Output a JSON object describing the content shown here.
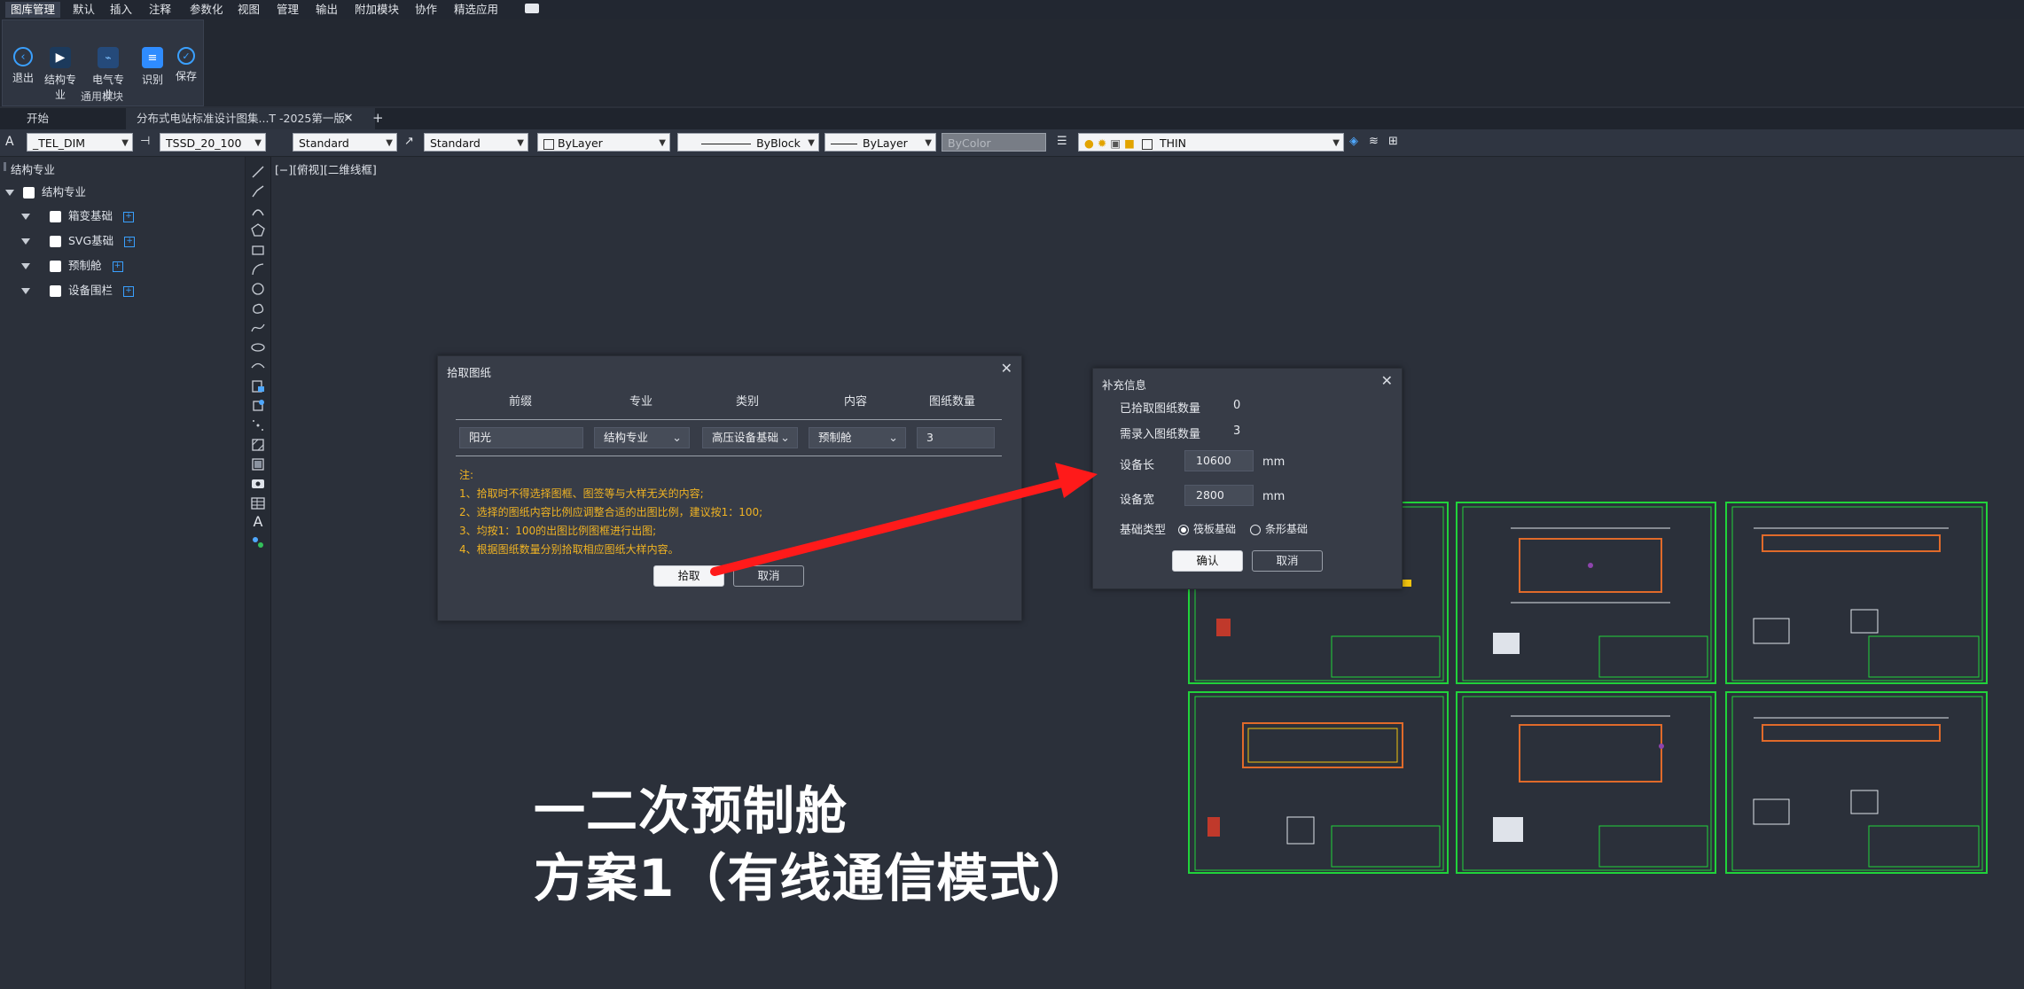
{
  "menu": [
    "图库管理",
    "默认",
    "插入",
    "注释",
    "参数化",
    "视图",
    "管理",
    "输出",
    "附加模块",
    "协作",
    "精选应用"
  ],
  "ribbon": {
    "buttons": [
      "退出",
      "结构专业",
      "电气专业",
      "识别",
      "保存"
    ],
    "group_label": "通用模块"
  },
  "tabs": {
    "start": "开始",
    "doc": "分布式电站标准设计图集...T -2025第一版*",
    "close": "×",
    "add": "+"
  },
  "props": {
    "dimstyle": "_TEL_DIM",
    "textstyle": "TSSD_20_100",
    "tablestyle": "Standard",
    "mleaderstyle": "Standard",
    "color": "ByLayer",
    "linetype": "ByBlock",
    "lineweight": "ByLayer",
    "plotstyle": "ByColor",
    "layer": "THIN"
  },
  "tree": {
    "panel_title": "结构专业",
    "root": "结构专业",
    "children": [
      "箱变基础",
      "SVG基础",
      "预制舱",
      "设备围栏"
    ]
  },
  "view_label": "[−][俯视][二维线框]",
  "pick_dialog": {
    "title": "拾取图纸",
    "columns": [
      "前缀",
      "专业",
      "类别",
      "内容",
      "图纸数量"
    ],
    "values": [
      "阳光",
      "结构专业",
      "高压设备基础",
      "预制舱",
      "3"
    ],
    "notes": [
      "注:",
      "1、拾取时不得选择图框、图签等与大样无关的内容;",
      "2、选择的图纸内容比例应调整合适的出图比例，建议按1：100;",
      "3、均按1：100的出图比例图框进行出图;",
      "4、根据图纸数量分别拾取相应图纸大样内容。"
    ],
    "pick_button": "拾取",
    "cancel_button": "取消"
  },
  "info_dialog": {
    "title": "补充信息",
    "picked_label": "已拾取图纸数量",
    "picked_value": "0",
    "needed_label": "需录入图纸数量",
    "needed_value": "3",
    "length_label": "设备长",
    "length_value": "10600",
    "width_label": "设备宽",
    "width_value": "2800",
    "unit": "mm",
    "foundation_label": "基础类型",
    "option_raft": "筏板基础",
    "option_strip": "条形基础",
    "confirm_button": "确认",
    "cancel_button": "取消"
  },
  "caption": {
    "line1": "一二次预制舱",
    "line2": "方案1（有线通信模式）"
  },
  "colors": {
    "accent_arrow": "#ff1a1a",
    "drawing_border": "#20d33a",
    "note_text": "#f0b323"
  }
}
